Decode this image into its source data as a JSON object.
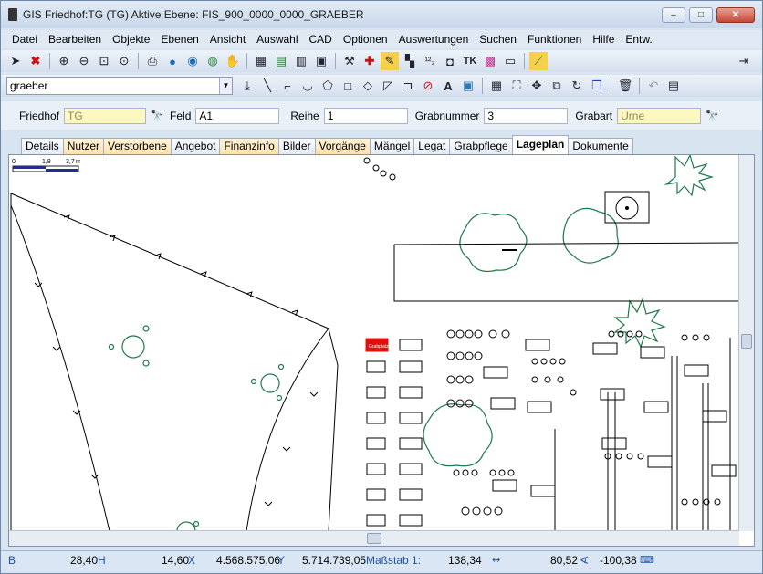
{
  "window": {
    "title": "GIS Friedhof:TG (TG) Aktive Ebene: FIS_900_0000_0000_GRAEBER",
    "min": "–",
    "max": "□",
    "close": "✕"
  },
  "menu": [
    "Datei",
    "Bearbeiten",
    "Objekte",
    "Ebenen",
    "Ansicht",
    "Auswahl",
    "CAD",
    "Optionen",
    "Auswertungen",
    "Suchen",
    "Funktionen",
    "Hilfe",
    "Entw."
  ],
  "layer_combo": {
    "value": "graeber"
  },
  "fields": {
    "friedhof_label": "Friedhof",
    "friedhof_value": "TG",
    "feld_label": "Feld",
    "feld_value": "A1",
    "reihe_label": "Reihe",
    "reihe_value": "1",
    "grabnummer_label": "Grabnummer",
    "grabnummer_value": "3",
    "grabart_label": "Grabart",
    "grabart_value": "Urne"
  },
  "tabs": [
    {
      "label": "Details",
      "style": "plain"
    },
    {
      "label": "Nutzer",
      "style": "orange"
    },
    {
      "label": "Verstorbene",
      "style": "orange"
    },
    {
      "label": "Angebot",
      "style": "plain"
    },
    {
      "label": "Finanzinfo",
      "style": "orange"
    },
    {
      "label": "Bilder",
      "style": "plain"
    },
    {
      "label": "Vorgänge",
      "style": "orange"
    },
    {
      "label": "Mängel",
      "style": "plain"
    },
    {
      "label": "Legat",
      "style": "plain"
    },
    {
      "label": "Grabpflege",
      "style": "plain"
    },
    {
      "label": "Lageplan",
      "style": "active"
    },
    {
      "label": "Dokumente",
      "style": "plain"
    }
  ],
  "scale": {
    "tick0": "0",
    "tick1": "1,8",
    "tick2": "3,7",
    "unit": "m"
  },
  "map": {
    "selected_label": "Grabplatz"
  },
  "status": {
    "mode": "B",
    "h_value": "28,40",
    "h_unit": "H",
    "x_value": "14,60",
    "x_unit": "X",
    "coord_y": "4.568.575,06",
    "coord_y_unit": "Y",
    "coord_x": "5.714.739,05",
    "massstab_label": "Maßstab 1:",
    "massstab_value": "138,34",
    "angle_value": "80,52",
    "angle2_value": "-100,38"
  },
  "colors": {
    "accent": "#1f4fa8",
    "tree": "#1f7a4a",
    "highlight": "#e01010"
  }
}
